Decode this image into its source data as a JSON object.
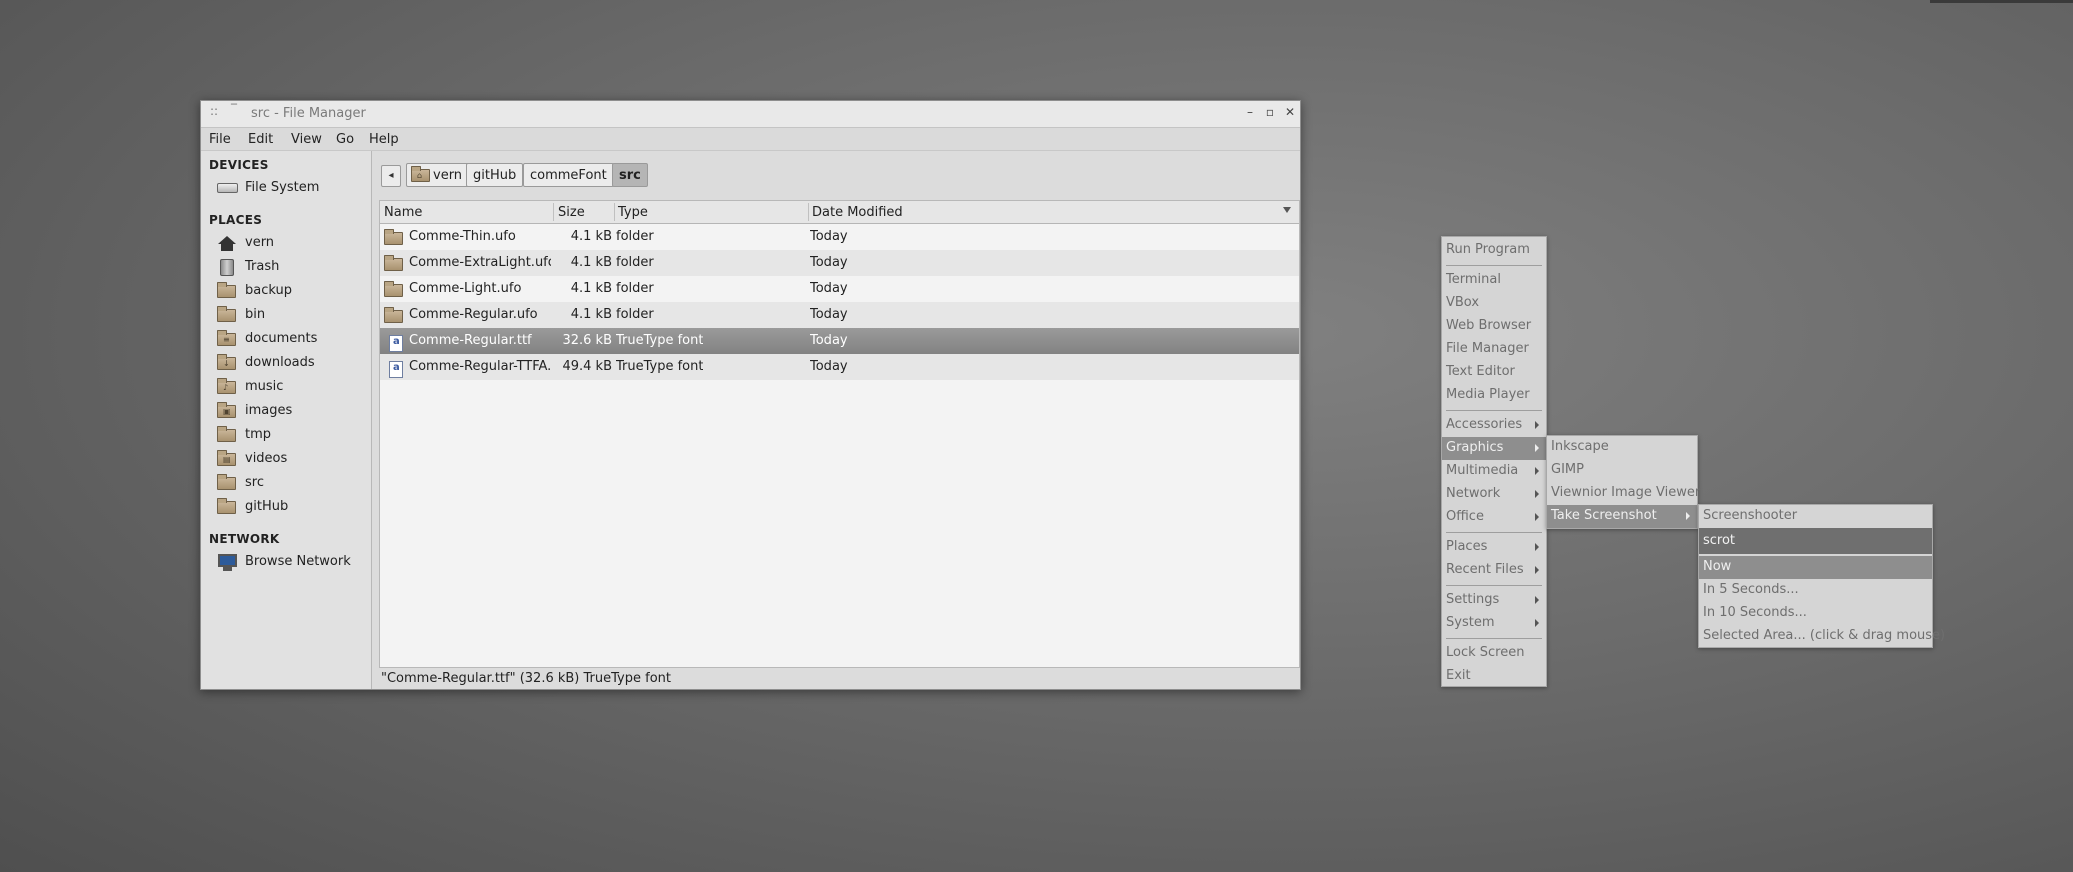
{
  "window": {
    "title": "src - File Manager",
    "grip_glyph": "::",
    "shade_glyph": "‾",
    "minimize_glyph": "–",
    "maximize_glyph": "▫",
    "close_glyph": "✕"
  },
  "menubar": [
    "File",
    "Edit",
    "View",
    "Go",
    "Help"
  ],
  "sidebar": {
    "devices_heading": "DEVICES",
    "devices": [
      {
        "label": "File System",
        "icon": "drive-icon"
      }
    ],
    "places_heading": "PLACES",
    "places": [
      {
        "label": "vern",
        "icon": "home-icon"
      },
      {
        "label": "Trash",
        "icon": "trash-icon"
      },
      {
        "label": "backup",
        "icon": "folder-icon"
      },
      {
        "label": "bin",
        "icon": "folder-icon"
      },
      {
        "label": "documents",
        "icon": "folder-icon"
      },
      {
        "label": "downloads",
        "icon": "folder-icon"
      },
      {
        "label": "music",
        "icon": "folder-icon"
      },
      {
        "label": "images",
        "icon": "folder-icon"
      },
      {
        "label": "tmp",
        "icon": "folder-icon"
      },
      {
        "label": "videos",
        "icon": "folder-icon"
      },
      {
        "label": "src",
        "icon": "folder-icon"
      },
      {
        "label": "gitHub",
        "icon": "folder-icon"
      }
    ],
    "network_heading": "NETWORK",
    "network": [
      {
        "label": "Browse Network",
        "icon": "network-icon"
      }
    ]
  },
  "pathbar": {
    "back_glyph": "◂",
    "crumbs": [
      "vern",
      "gitHub",
      "commeFont",
      "src"
    ],
    "active": "src"
  },
  "file_list": {
    "columns": [
      "Name",
      "Size",
      "Type",
      "Date Modified"
    ],
    "rows": [
      {
        "name": "Comme-Thin.ufo",
        "size": "4.1 kB",
        "type": "folder",
        "date": "Today",
        "icon": "folder-icon"
      },
      {
        "name": "Comme-ExtraLight.ufo",
        "size": "4.1 kB",
        "type": "folder",
        "date": "Today",
        "icon": "folder-icon"
      },
      {
        "name": "Comme-Light.ufo",
        "size": "4.1 kB",
        "type": "folder",
        "date": "Today",
        "icon": "folder-icon"
      },
      {
        "name": "Comme-Regular.ufo",
        "size": "4.1 kB",
        "type": "folder",
        "date": "Today",
        "icon": "folder-icon"
      },
      {
        "name": "Comme-Regular.ttf",
        "size": "32.6 kB",
        "type": "TrueType font",
        "date": "Today",
        "icon": "font-file-icon",
        "selected": true
      },
      {
        "name": "Comme-Regular-TTFA.ttf",
        "size": "49.4 kB",
        "type": "TrueType font",
        "date": "Today",
        "icon": "font-file-icon"
      }
    ]
  },
  "statusbar": {
    "text": "\"Comme-Regular.ttf\" (32.6 kB) TrueType font"
  },
  "root_menu": {
    "items": [
      "Run Program",
      "Terminal",
      "VBox",
      "Web Browser",
      "File Manager",
      "Text Editor",
      "Media Player",
      "Accessories",
      "Graphics",
      "Multimedia",
      "Network",
      "Office",
      "Places",
      "Recent Files",
      "Settings",
      "System",
      "Lock Screen",
      "Exit"
    ]
  },
  "graphics_menu": {
    "items": [
      "Inkscape",
      "GIMP",
      "Viewnior Image Viewer",
      "Take Screenshot"
    ]
  },
  "screenshot_menu": {
    "items": [
      "Screenshooter",
      "scrot",
      "Now",
      "In 5 Seconds...",
      "In 10 Seconds...",
      "Selected Area... (click & drag mouse)"
    ]
  },
  "colors": {
    "desktop": "#6b6b6b",
    "menu_bg": "#d5d5d5",
    "highlight": "#8e8e8e",
    "selection": "#8a8a8a"
  }
}
